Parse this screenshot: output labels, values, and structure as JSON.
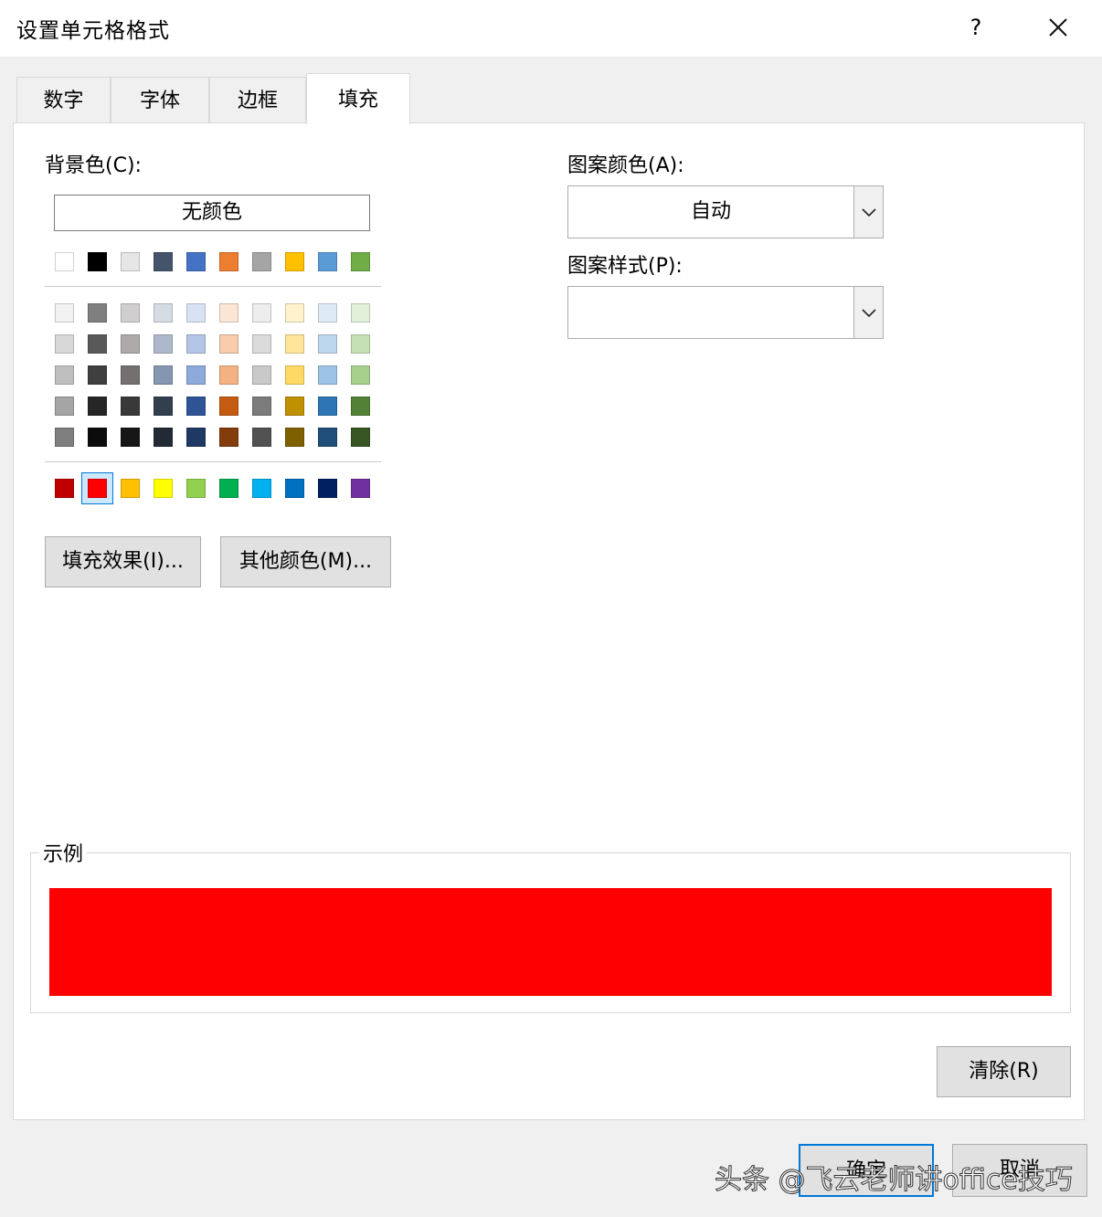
{
  "dialog": {
    "title": "设置单元格格式",
    "help_label": "?",
    "close_icon": "close-icon"
  },
  "tabs": [
    {
      "label": "数字",
      "active": false
    },
    {
      "label": "字体",
      "active": false
    },
    {
      "label": "边框",
      "active": false
    },
    {
      "label": "填充",
      "active": true
    }
  ],
  "fill": {
    "background_label": "背景色(C):",
    "no_color_label": "无颜色",
    "theme_row": [
      "#ffffff",
      "#000000",
      "#e7e6e6",
      "#44546a",
      "#4472c4",
      "#ed7d31",
      "#a5a5a5",
      "#ffc000",
      "#5b9bd5",
      "#70ad47"
    ],
    "tint_rows": [
      [
        "#f2f2f2",
        "#7f7f7f",
        "#d0cece",
        "#d6dce4",
        "#d9e2f3",
        "#fbe5d5",
        "#ededed",
        "#fff2cc",
        "#deebf6",
        "#e2efd9"
      ],
      [
        "#d8d8d8",
        "#595959",
        "#aeaaaa",
        "#adb9ca",
        "#b4c6e7",
        "#f7cbac",
        "#dbdbdb",
        "#fee599",
        "#bdd7ee",
        "#c5e0b3"
      ],
      [
        "#bfbfbf",
        "#3f3f3f",
        "#757070",
        "#8496b0",
        "#8eaadb",
        "#f4b183",
        "#c9c9c9",
        "#ffd965",
        "#9dc3e6",
        "#a8d08d"
      ],
      [
        "#a5a5a5",
        "#262626",
        "#3a3838",
        "#323f4f",
        "#2f5496",
        "#c55a11",
        "#7b7b7b",
        "#bf9000",
        "#2e75b5",
        "#538135"
      ],
      [
        "#7f7f7f",
        "#0c0c0c",
        "#171616",
        "#222a35",
        "#1f3864",
        "#833c0b",
        "#525252",
        "#7f6000",
        "#1e4e79",
        "#375623"
      ]
    ],
    "standard_row": [
      "#c00000",
      "#ff0000",
      "#ffc000",
      "#ffff00",
      "#92d050",
      "#00b050",
      "#00b0f0",
      "#0070c0",
      "#002060",
      "#7030a0"
    ],
    "selected_standard_index": 1,
    "fill_effects_label": "填充效果(I)...",
    "more_colors_label": "其他颜色(M)...",
    "pattern_color_label": "图案颜色(A):",
    "pattern_color_value": "自动",
    "pattern_style_label": "图案样式(P):",
    "pattern_style_value": "",
    "sample_label": "示例",
    "sample_color": "#ff0000",
    "clear_label": "清除(R)"
  },
  "footer": {
    "ok_label": "确定",
    "cancel_label": "取消"
  },
  "watermark": "头条 @飞云老师讲office技巧"
}
